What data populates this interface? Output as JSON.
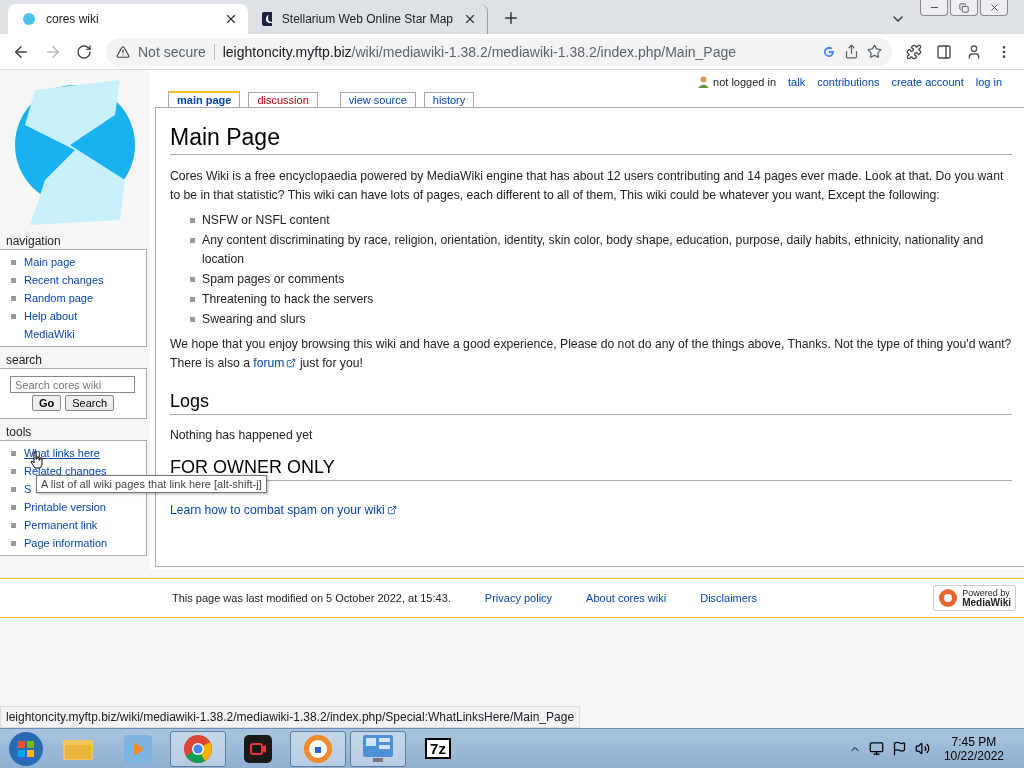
{
  "browser": {
    "tabs": [
      {
        "title": "cores wiki",
        "selected": true
      },
      {
        "title": "Stellarium Web Online Star Map",
        "selected": false
      }
    ],
    "security": "Not secure",
    "url_host": "leightoncity.myftp.biz",
    "url_path": "/wiki/mediawiki-1.38.2/mediawiki-1.38.2/index.php/Main_Page"
  },
  "personal_tools": [
    "not logged in",
    "talk",
    "contributions",
    "create account",
    "log in"
  ],
  "page_tabs": [
    {
      "label": "main page",
      "selected": true,
      "kind": "page"
    },
    {
      "label": "discussion",
      "selected": false,
      "kind": "new"
    },
    {
      "label": "view source",
      "selected": false,
      "kind": "action"
    },
    {
      "label": "history",
      "selected": false,
      "kind": "action"
    }
  ],
  "sidebar": {
    "navigation": {
      "title": "navigation",
      "items": [
        "Main page",
        "Recent changes",
        "Random page",
        "Help about MediaWiki"
      ]
    },
    "search": {
      "title": "search",
      "placeholder": "Search cores wiki",
      "buttons": [
        "Go",
        "Search"
      ]
    },
    "tools": {
      "title": "tools",
      "items": [
        {
          "label": "What links here",
          "hovered": true
        },
        {
          "label": "Related changes",
          "hovered": false
        },
        {
          "label": "S",
          "hovered": false
        },
        {
          "label": "Printable version",
          "hovered": false
        },
        {
          "label": "Permanent link",
          "hovered": false
        },
        {
          "label": "Page information",
          "hovered": false
        }
      ]
    }
  },
  "tooltip": "A list of all wiki pages that link here [alt-shift-j]",
  "content": {
    "title": "Main Page",
    "intro": "Cores Wiki is a free encyclopaedia powered by MediaWiki engine that has about 12 users contributing and 14 pages ever made. Look at that. Do you want to be in that statistic? This wiki can have lots of pages, each different to all of them, This wiki could be whatever you want, Except the following:",
    "rules": [
      "NSFW or NSFL content",
      "Any content discriminating by race, religion, orientation, identity, skin color, body shape, education, purpose, daily habits, ethnicity, nationality and location",
      "Spam pages or comments",
      "Threatening to hack the servers",
      "Swearing and slurs"
    ],
    "outro_before": "We hope that you enjoy browsing this wiki and have a good experience, Please do not do any of the things above, Thanks. Not the type of thing you'd want? There is also a",
    "outro_link": "forum",
    "outro_after": "just for you!",
    "logs_heading": "Logs",
    "logs_text": "Nothing has happened yet",
    "owner_heading": "FOR OWNER ONLY",
    "owner_link": "Learn how to combat spam on your wiki"
  },
  "footer": {
    "modified": "This page was last modified on 5 October 2022, at 15:43.",
    "links": [
      "Privacy policy",
      "About cores wiki",
      "Disclaimers"
    ],
    "badge_top": "Powered by",
    "badge_bottom": "MediaWiki"
  },
  "status_url": "leightoncity.myftp.biz/wiki/mediawiki-1.38.2/mediawiki-1.38.2/index.php/Special:WhatLinksHere/Main_Page",
  "taskbar": {
    "time": "7:45 PM",
    "date": "10/22/2022",
    "zip_label": "7z"
  }
}
